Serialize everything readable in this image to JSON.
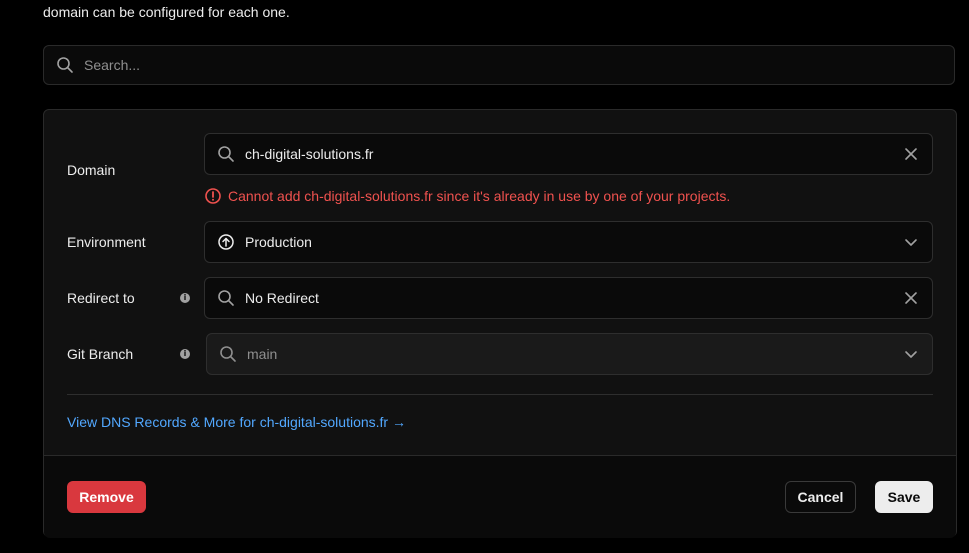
{
  "intro": {
    "text": "domain can be configured for each one."
  },
  "search": {
    "placeholder": "Search...",
    "value": ""
  },
  "form": {
    "domain": {
      "label": "Domain",
      "value": "ch-digital-solutions.fr",
      "error": "Cannot add ch-digital-solutions.fr since it's already in use by one of your projects."
    },
    "environment": {
      "label": "Environment",
      "value": "Production"
    },
    "redirect": {
      "label": "Redirect to",
      "info": "i",
      "value": "No Redirect"
    },
    "git_branch": {
      "label": "Git Branch",
      "info": "i",
      "placeholder": "main"
    },
    "dns_link": "View DNS Records & More for ch-digital-solutions.fr →"
  },
  "footer": {
    "remove_label": "Remove",
    "cancel_label": "Cancel",
    "save_label": "Save"
  },
  "colors": {
    "error": "#f0524f",
    "link": "#52a8ff",
    "remove": "#d9383e"
  },
  "icons": {
    "search": "search-icon",
    "clear": "close-icon",
    "environment": "arrow-up-circle-icon",
    "dropdown": "chevron-down-icon",
    "error": "alert-circle-icon",
    "info": "info-icon"
  }
}
